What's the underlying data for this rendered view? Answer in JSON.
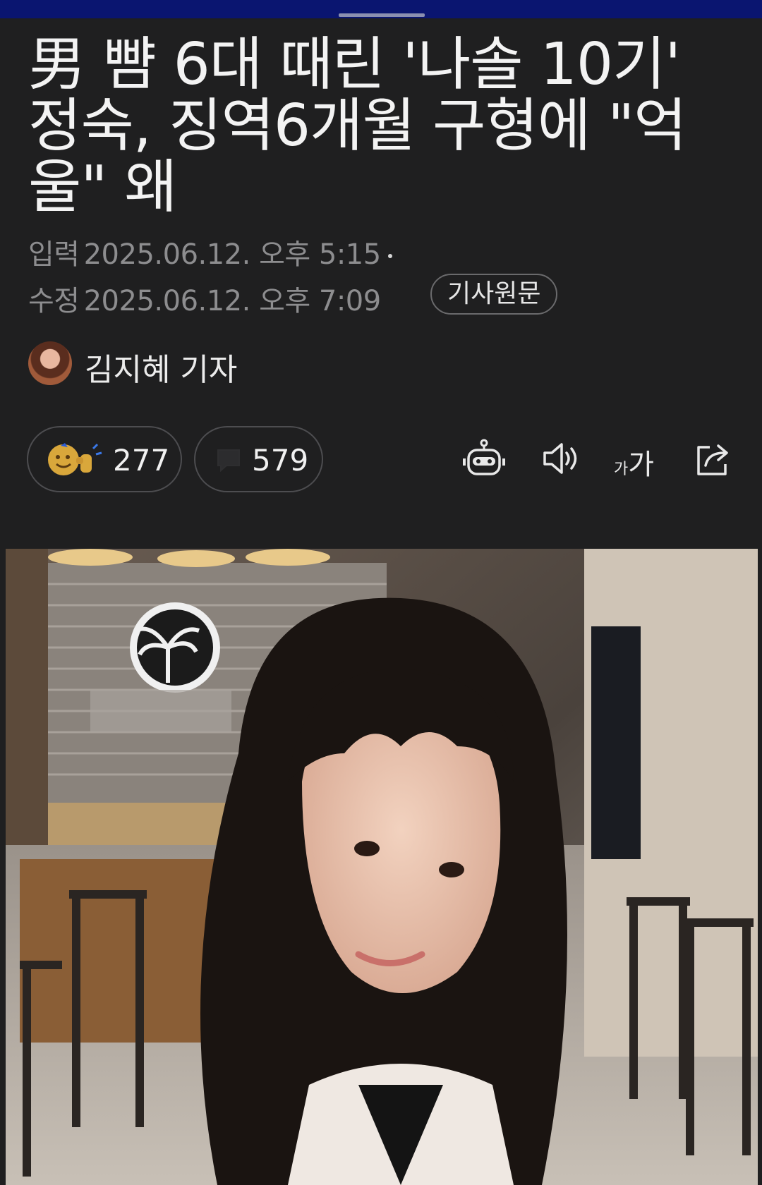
{
  "article": {
    "headline": "男 뺨 6대 때린 '나솔 10기' 정숙, 징역6개월 구형에 \"억울\" 왜",
    "input_label": "입력",
    "input_time": "2025.06.12. 오후 5:15",
    "edit_label": "수정",
    "edit_time": "2025.06.12. 오후 7:09",
    "original_button": "기사원문",
    "author": "김지혜 기자"
  },
  "reactions": {
    "like_count": "277",
    "comment_count": "579"
  },
  "toolbar": {
    "font_small": "가",
    "font_big": "가",
    "icons": [
      "robot-summary-icon",
      "speaker-icon",
      "font-size-icon",
      "share-icon"
    ]
  },
  "colors": {
    "background": "#1f1f20",
    "top_bar": "#0a1570",
    "meta_text": "#8d8d8f"
  }
}
